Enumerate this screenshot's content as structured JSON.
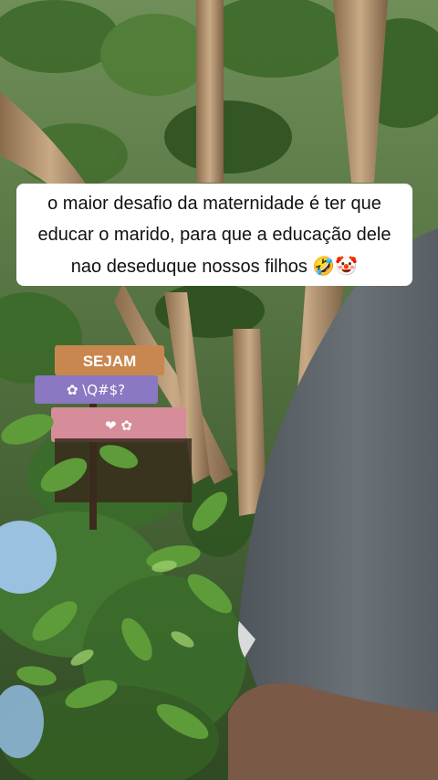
{
  "caption": {
    "text": "o maior desafio da maternidade é ter que educar o marido, para que a educação dele nao deseduque nossos filhos",
    "emojis": "🤣🤡"
  },
  "signs": {
    "top": "SEJAM",
    "middle": "✿ \\Q#$?",
    "bottom": "❤ ✿"
  },
  "colors": {
    "foliage": "#3f6b2c",
    "trunk": "#b89570",
    "shirt": "#5f666c",
    "caption_bg": "#ffffff"
  }
}
